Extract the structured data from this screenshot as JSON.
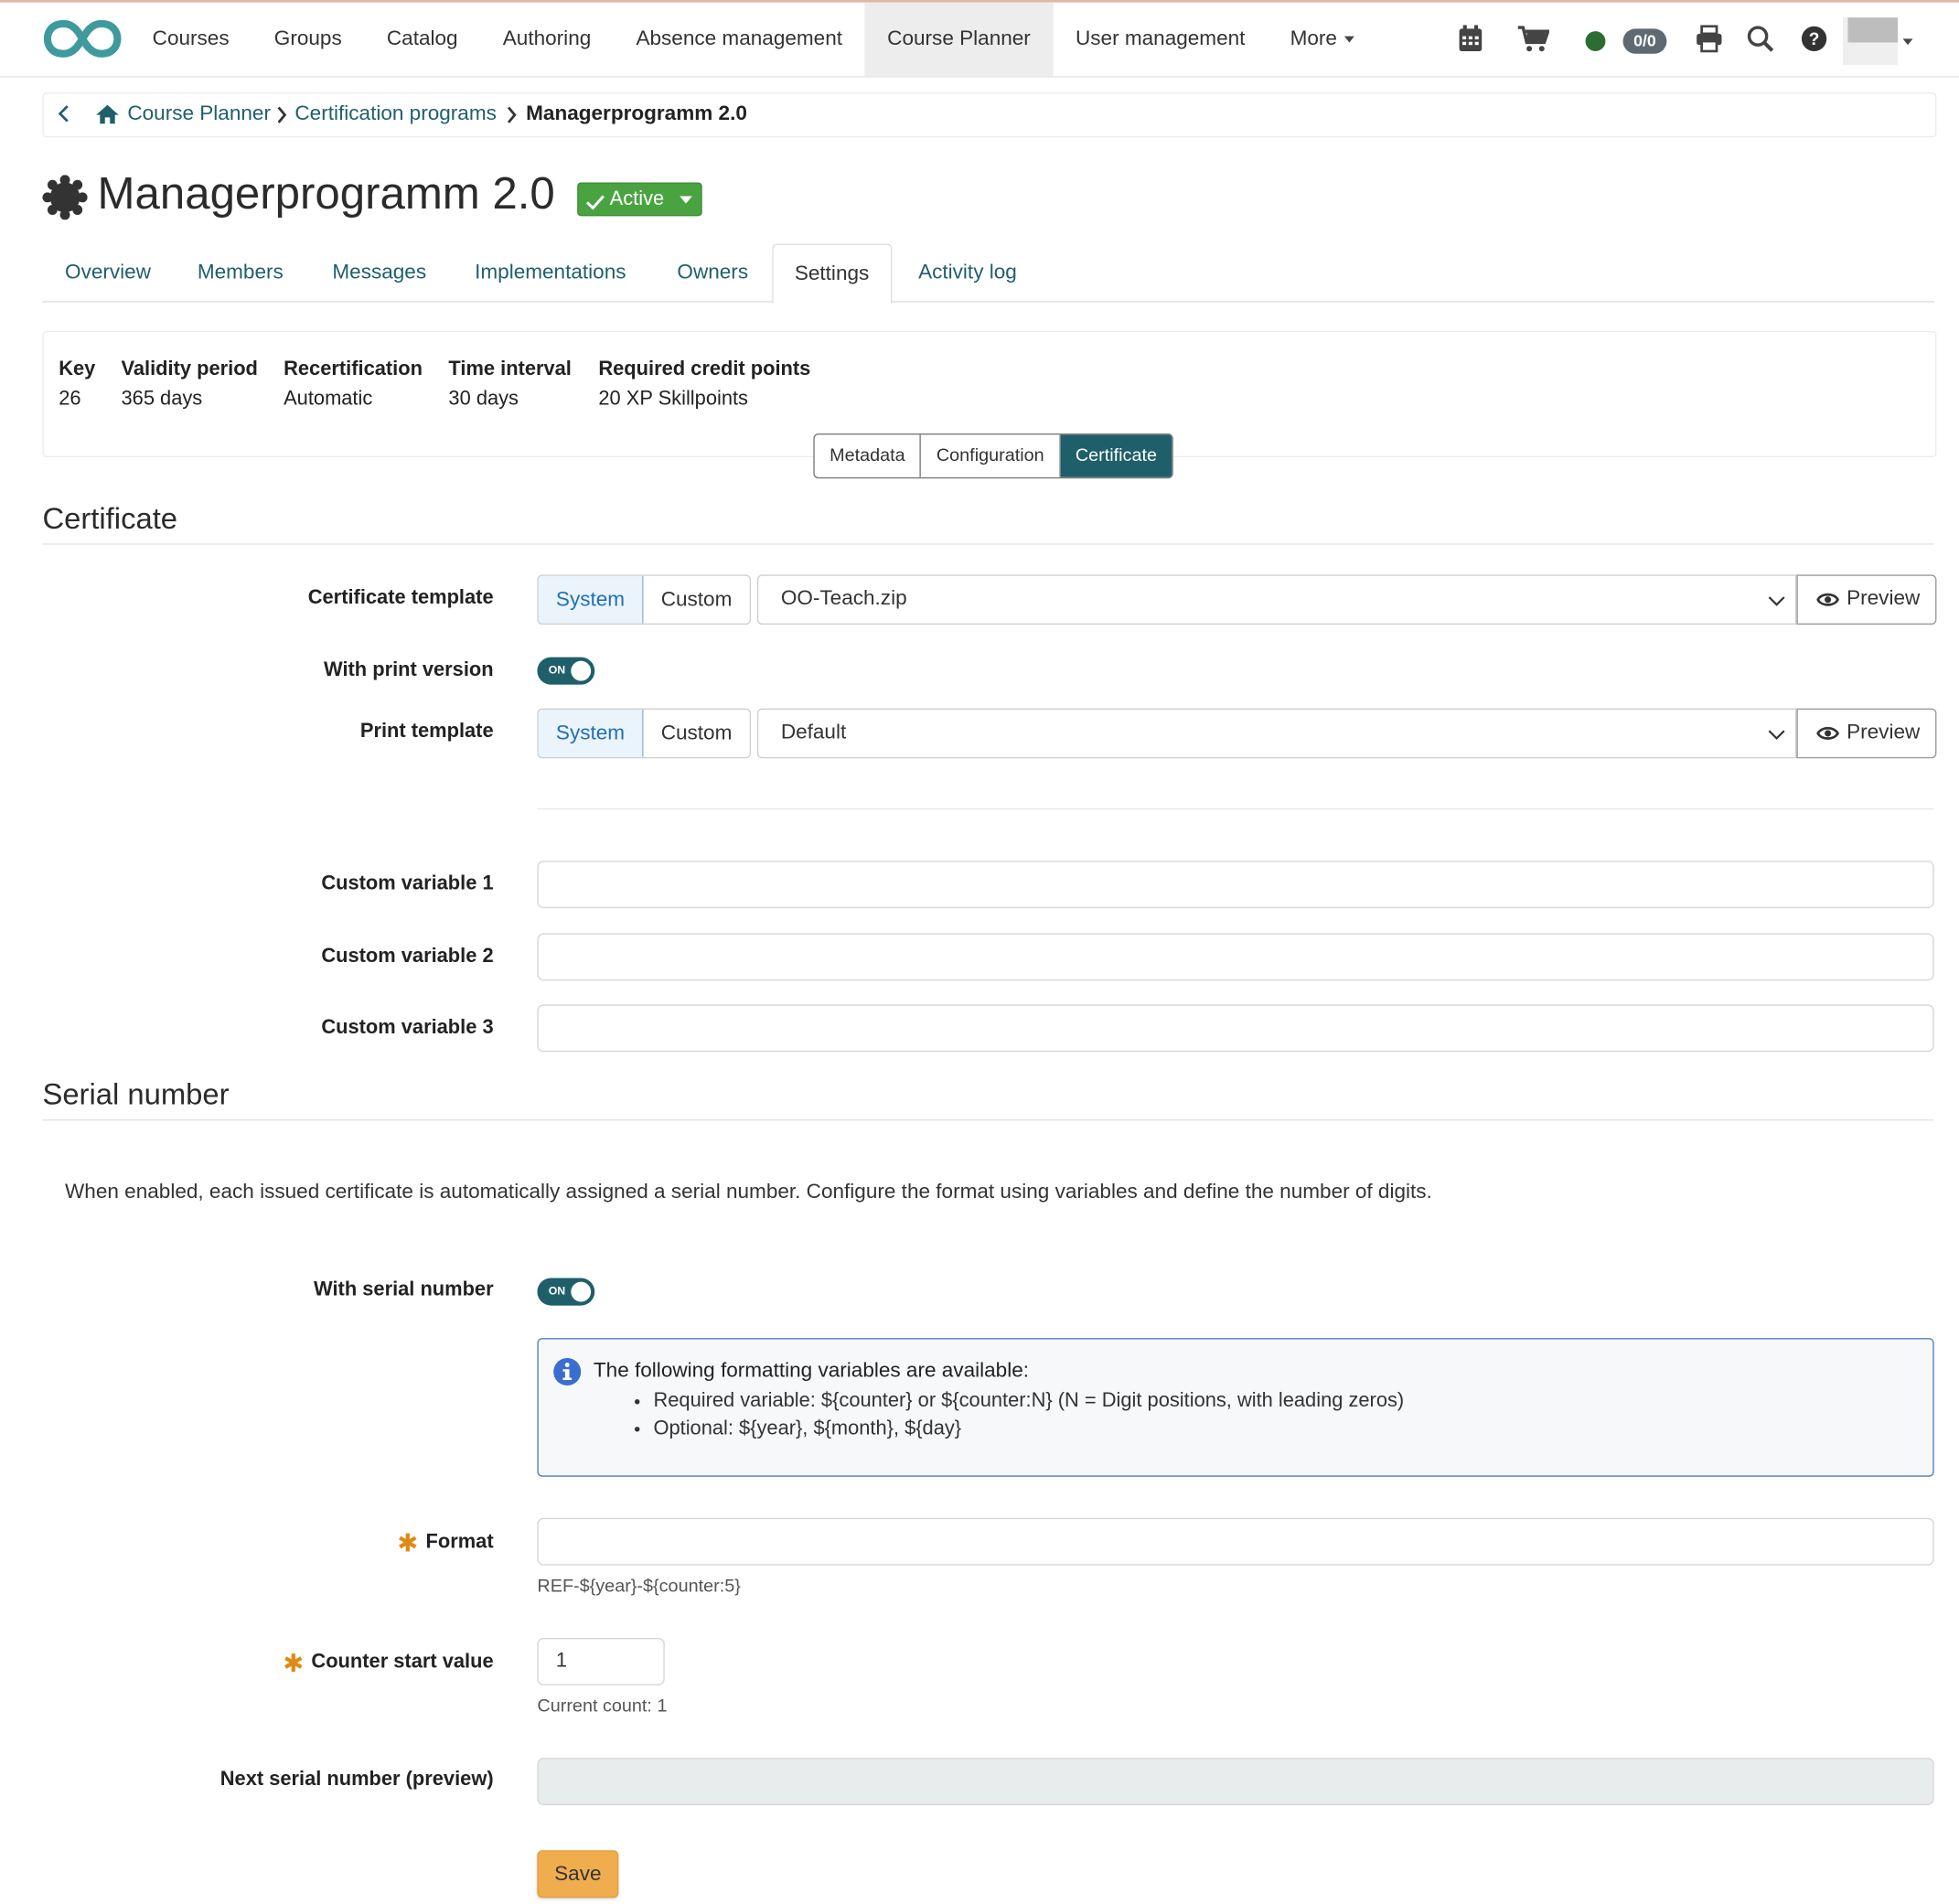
{
  "nav": {
    "items": [
      {
        "label": "Courses",
        "active": false
      },
      {
        "label": "Groups",
        "active": false
      },
      {
        "label": "Catalog",
        "active": false
      },
      {
        "label": "Authoring",
        "active": false
      },
      {
        "label": "Absence management",
        "active": false
      },
      {
        "label": "Course Planner",
        "active": true
      },
      {
        "label": "User management",
        "active": false
      },
      {
        "label": "More",
        "active": false
      }
    ],
    "badge": "0/0",
    "logo_color": "#3f9a9e"
  },
  "breadcrumb": {
    "items": [
      "Course Planner",
      "Certification programs"
    ],
    "current": "Managerprogramm 2.0"
  },
  "page": {
    "title": "Managerprogramm 2.0",
    "status": "Active",
    "status_color": "#4aa341"
  },
  "tabs": [
    "Overview",
    "Members",
    "Messages",
    "Implementations",
    "Owners",
    "Settings",
    "Activity log"
  ],
  "active_tab": "Settings",
  "info": [
    {
      "key": "Key",
      "value": "26"
    },
    {
      "key": "Validity period",
      "value": "365 days"
    },
    {
      "key": "Recertification",
      "value": "Automatic"
    },
    {
      "key": "Time interval",
      "value": "30 days"
    },
    {
      "key": "Required credit points",
      "value": "20 XP Skillpoints"
    }
  ],
  "subtabs": [
    "Metadata",
    "Configuration",
    "Certificate"
  ],
  "certificate": {
    "heading": "Certificate",
    "template_label": "Certificate template",
    "seg_system": "System",
    "seg_custom": "Custom",
    "template_value": "OO-Teach.zip",
    "preview_label": "Preview",
    "print_version_label": "With print version",
    "toggle_on": "ON",
    "print_template_label": "Print template",
    "print_template_value": "Default",
    "custom_var_1": "Custom variable 1",
    "custom_var_2": "Custom variable 2",
    "custom_var_3": "Custom variable 3"
  },
  "serial": {
    "heading": "Serial number",
    "description": "When enabled, each issued certificate is automatically assigned a serial number. Configure the format using variables and define the number of digits.",
    "with_serial_label": "With serial number",
    "info_title": "The following formatting variables are available:",
    "info_items": [
      "Required variable: ${counter} or ${counter:N} (N = Digit positions, with leading zeros)",
      "Optional: ${year}, ${month}, ${day}"
    ],
    "format_label": "Format",
    "format_value": "",
    "format_help": "REF-${year}-${counter:5}",
    "counter_label": "Counter start value",
    "counter_value": "1",
    "counter_help": "Current count: 1",
    "next_label": "Next serial number (preview)",
    "next_value": "",
    "save_label": "Save",
    "accent_color": "#1f5f6a",
    "save_color": "#f0ad4e"
  }
}
